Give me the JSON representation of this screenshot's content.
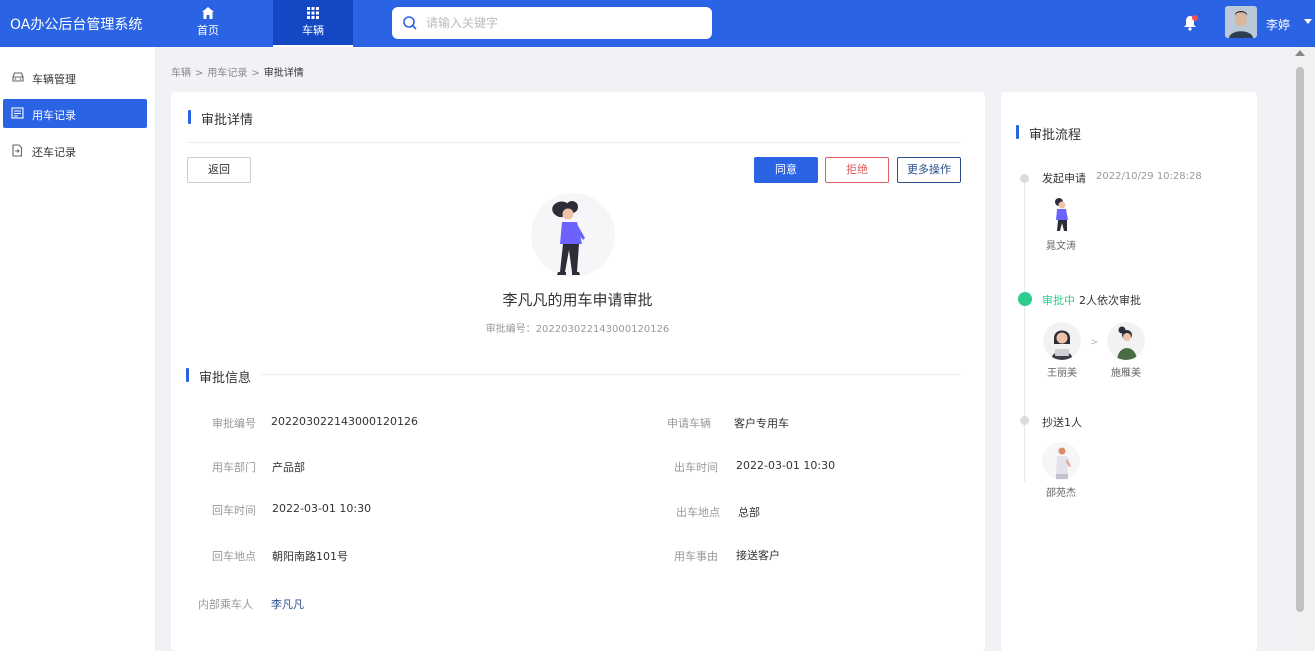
{
  "app": {
    "title": "OA办公后台管理系统"
  },
  "nav": [
    {
      "label": "首页",
      "icon": "home-icon",
      "active": false
    },
    {
      "label": "车辆",
      "icon": "grid-icon",
      "active": true
    }
  ],
  "search": {
    "placeholder": "请输入关键字",
    "value": ""
  },
  "user": {
    "name": "李婷",
    "has_notification": true
  },
  "sidebar": {
    "items": [
      {
        "label": "车辆管理",
        "icon": "car-icon",
        "active": false
      },
      {
        "label": "用车记录",
        "icon": "list-icon",
        "active": true
      },
      {
        "label": "还车记录",
        "icon": "return-icon",
        "active": false
      }
    ]
  },
  "breadcrumb": [
    "车辆",
    "用车记录",
    "审批详情"
  ],
  "detail": {
    "section_title": "审批详情",
    "buttons": {
      "back": "返回",
      "agree": "同意",
      "reject": "拒绝",
      "more": "更多操作"
    },
    "apply_title": "李凡凡的用车申请审批",
    "apply_no_label": "审批编号：",
    "apply_no": "202203022143000120126"
  },
  "info": {
    "section_title": "审批信息",
    "left": [
      {
        "label": "审批编号",
        "value": "202203022143000120126"
      },
      {
        "label": "用车部门",
        "value": "产品部"
      },
      {
        "label": "回车时间",
        "value": "2022-03-01 10:30"
      },
      {
        "label": "回车地点",
        "value": "朝阳南路101号"
      },
      {
        "label": "内部乘车人",
        "value": "李凡凡"
      }
    ],
    "right": [
      {
        "label": "申请车辆",
        "value": "客户专用车"
      },
      {
        "label": "出车时间",
        "value": "2022-03-01 10:30"
      },
      {
        "label": "出车地点",
        "value": "总部"
      },
      {
        "label": "用车事由",
        "value": "接送客户"
      }
    ]
  },
  "flow": {
    "section_title": "审批流程",
    "steps": [
      {
        "title": "发起申请",
        "time": "2022/10/29 10:28:28",
        "people": [
          "晁文涛"
        ]
      },
      {
        "status": "审批中",
        "title": "2人依次审批",
        "people": [
          "王丽美",
          "施雁美"
        ]
      },
      {
        "title": "抄送1人",
        "people": [
          "邵苑杰"
        ]
      }
    ]
  }
}
